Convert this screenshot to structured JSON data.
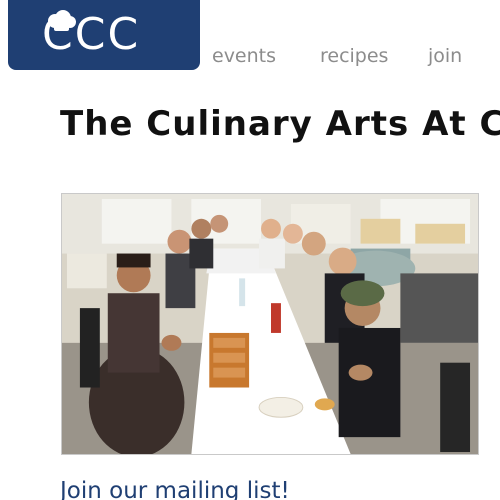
{
  "header": {
    "logo_text": "CCC",
    "logo_icon": "chef-hat-icon"
  },
  "nav": {
    "items": [
      {
        "label": "events"
      },
      {
        "label": "recipes"
      },
      {
        "label": "join"
      }
    ]
  },
  "main": {
    "title": "The Culinary Arts At C",
    "mailing_list_label": "Join our mailing list!"
  },
  "colors": {
    "brand_navy": "#1f3f73",
    "nav_gray": "#8c8c8c",
    "title_black": "#111111"
  }
}
